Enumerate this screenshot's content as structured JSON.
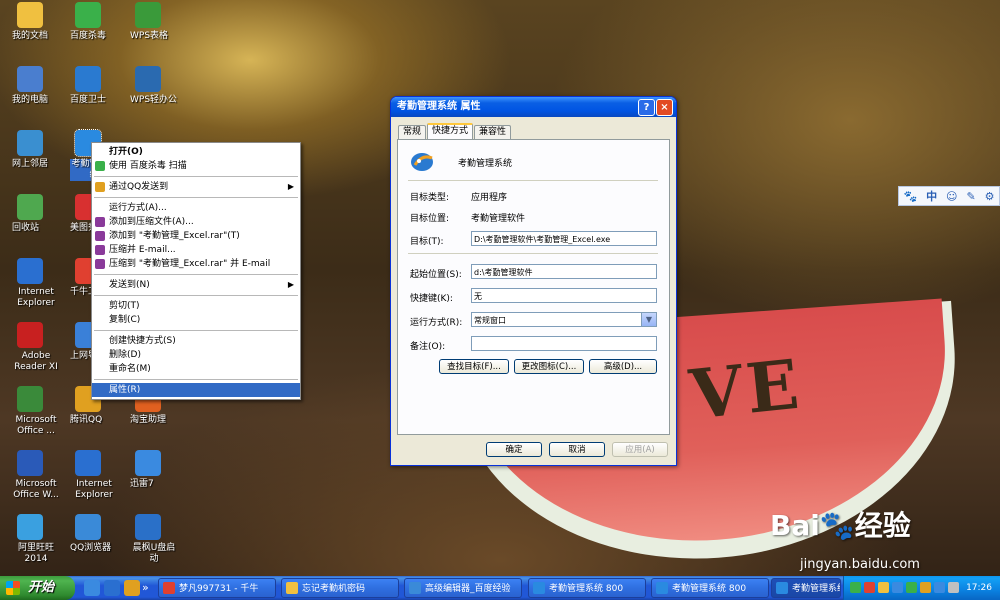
{
  "desktop_icons": [
    {
      "label": "我的文档",
      "color": "#f0c040"
    },
    {
      "label": "我的电脑",
      "color": "#4a7ecf"
    },
    {
      "label": "网上邻居",
      "color": "#3a8fd0"
    },
    {
      "label": "回收站",
      "color": "#4fa84f"
    },
    {
      "label": "Internet Explorer",
      "color": "#2a6fd0"
    },
    {
      "label": "Adobe Reader XI",
      "color": "#c82020"
    },
    {
      "label": "Microsoft Office ...",
      "color": "#3a8a3a"
    },
    {
      "label": "Microsoft Office W...",
      "color": "#2a5ab8"
    },
    {
      "label": "阿里旺旺 2014",
      "color": "#3aa0e0"
    },
    {
      "label": "百度杀毒",
      "color": "#3ab04a"
    },
    {
      "label": "百度卫士",
      "color": "#2a7ad0"
    },
    {
      "label": "考勤管理系统",
      "color": "#2a8ae0"
    },
    {
      "label": "美图秀",
      "color": "#d83030"
    },
    {
      "label": "千牛工",
      "color": "#e04030"
    },
    {
      "label": "上网导",
      "color": "#3a80d8"
    },
    {
      "label": "腾讯QQ",
      "color": "#e0a020"
    },
    {
      "label": "Internet Explorer",
      "color": "#2a6fd0"
    },
    {
      "label": "QQ浏览器",
      "color": "#3a8ad8"
    },
    {
      "label": "WPS表格",
      "color": "#3a9a3a"
    },
    {
      "label": "WPS轻办公",
      "color": "#2a6ab0"
    },
    {
      "label": "淘宝助理",
      "color": "#e06020"
    },
    {
      "label": "迅雷7",
      "color": "#3a8ae0"
    },
    {
      "label": "晨枫U盘启动",
      "color": "#2a70c8"
    }
  ],
  "context_menu": {
    "items": [
      {
        "label": "打开(O)",
        "bold": true
      },
      {
        "label": "使用 百度杀毒 扫描",
        "icon": "#3ab04a"
      },
      {
        "sep": true
      },
      {
        "label": "通过QQ发送到",
        "icon": "#e0a020",
        "submenu": true
      },
      {
        "sep": true
      },
      {
        "label": "运行方式(A)..."
      },
      {
        "label": "添加到压缩文件(A)...",
        "icon": "#8a3a9a"
      },
      {
        "label": "添加到 \"考勤管理_Excel.rar\"(T)",
        "icon": "#8a3a9a"
      },
      {
        "label": "压缩并 E-mail...",
        "icon": "#8a3a9a"
      },
      {
        "label": "压缩到 \"考勤管理_Excel.rar\" 并 E-mail",
        "icon": "#8a3a9a"
      },
      {
        "sep": true
      },
      {
        "label": "发送到(N)",
        "submenu": true
      },
      {
        "sep": true
      },
      {
        "label": "剪切(T)"
      },
      {
        "label": "复制(C)"
      },
      {
        "sep": true
      },
      {
        "label": "创建快捷方式(S)"
      },
      {
        "label": "删除(D)"
      },
      {
        "label": "重命名(M)"
      },
      {
        "sep": true
      },
      {
        "label": "属性(R)",
        "highlight": true
      }
    ]
  },
  "dialog": {
    "title": "考勤管理系统 属性",
    "help": "?",
    "close": "×",
    "tabs": [
      "常规",
      "快捷方式",
      "兼容性"
    ],
    "app_name": "考勤管理系统",
    "target_type_label": "目标类型:",
    "target_type_value": "应用程序",
    "target_loc_label": "目标位置:",
    "target_loc_value": "考勤管理软件",
    "target_label": "目标(T):",
    "target_value": "D:\\考勤管理软件\\考勤管理_Excel.exe",
    "start_label": "起始位置(S):",
    "start_value": "d:\\考勤管理软件",
    "hotkey_label": "快捷键(K):",
    "hotkey_value": "无",
    "run_label": "运行方式(R):",
    "run_value": "常规窗口",
    "comment_label": "备注(O):",
    "comment_value": "",
    "btn_find": "查找目标(F)...",
    "btn_icon": "更改图标(C)...",
    "btn_adv": "高级(D)...",
    "btn_ok": "确定",
    "btn_cancel": "取消",
    "btn_apply": "应用(A)"
  },
  "ime_bar": {
    "items": [
      "🐾",
      "中",
      "☺",
      "✎",
      "⚙"
    ]
  },
  "watermark": {
    "brand": "Bai🐾经验",
    "url": "jingyan.baidu.com"
  },
  "taskbar": {
    "start": "开始",
    "quicklaunch_colors": [
      "#3a8ae0",
      "#2a6fd0",
      "#e0a020"
    ],
    "quicklaunch_more": "»",
    "buttons": [
      {
        "label": "梦凡997731 - 千牛",
        "color": "#e04030"
      },
      {
        "label": "忘记考勤机密码",
        "color": "#f0c040"
      },
      {
        "label": "高级编辑器_百度经验",
        "color": "#3a8ad8"
      },
      {
        "label": "考勤管理系统 800",
        "color": "#2a8ae0"
      },
      {
        "label": "考勤管理系统 800",
        "color": "#2a8ae0"
      },
      {
        "label": "考勤管理系统 属性",
        "color": "#2a8ae0"
      }
    ],
    "tray_colors": [
      "#3ab04a",
      "#e04030",
      "#f0c040",
      "#3a8ae0",
      "#3ab04a",
      "#e0a020",
      "#3a8ae0",
      "#c0c0c0"
    ],
    "clock": "17:26"
  }
}
